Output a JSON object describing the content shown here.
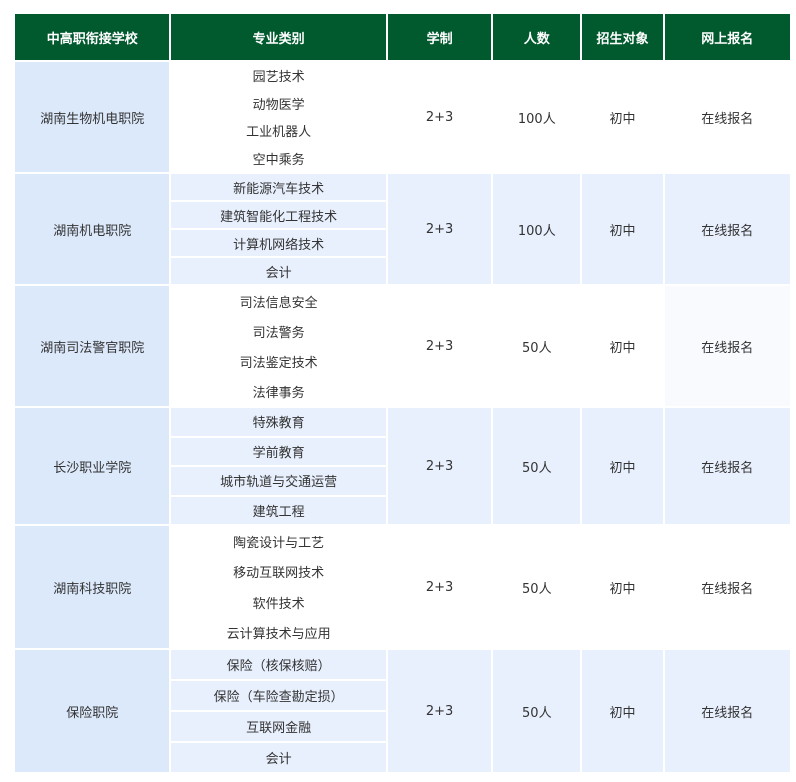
{
  "header": {
    "col_school": "中高职衔接学校",
    "col_major": "专业类别",
    "col_duration": "学制",
    "col_count": "人数",
    "col_target": "招生对象",
    "col_signup": "网上报名"
  },
  "rows": [
    {
      "school": "湖南生物机电职院",
      "majors": [
        "园艺技术",
        "动物医学",
        "工业机器人",
        "空中乘务"
      ],
      "duration": "2+3",
      "count": "100人",
      "target": "初中",
      "signup": "在线报名"
    },
    {
      "school": "湖南机电职院",
      "majors": [
        "新能源汽车技术",
        "建筑智能化工程技术",
        "计算机网络技术",
        "会计"
      ],
      "duration": "2+3",
      "count": "100人",
      "target": "初中",
      "signup": "在线报名"
    },
    {
      "school": "湖南司法警官职院",
      "majors": [
        "司法信息安全",
        "司法警务",
        "司法鉴定技术",
        "法律事务"
      ],
      "duration": "2+3",
      "count": "50人",
      "target": "初中",
      "signup": "在线报名"
    },
    {
      "school": "长沙职业学院",
      "majors": [
        "特殊教育",
        "学前教育",
        "城市轨道与交通运营",
        "建筑工程"
      ],
      "duration": "2+3",
      "count": "50人",
      "target": "初中",
      "signup": "在线报名"
    },
    {
      "school": "湖南科技职院",
      "majors": [
        "陶瓷设计与工艺",
        "移动互联网技术",
        "软件技术",
        "云计算技术与应用"
      ],
      "duration": "2+3",
      "count": "50人",
      "target": "初中",
      "signup": "在线报名"
    },
    {
      "school": "保险职院",
      "majors": [
        "保险（核保核赔）",
        "保险（车险查勘定损）",
        "互联网金融",
        "会计"
      ],
      "duration": "2+3",
      "count": "50人",
      "target": "初中",
      "signup": "在线报名"
    }
  ],
  "colors": {
    "header_bg": "#005a2e",
    "school_bg": "#dce9fb",
    "alt_row_bg": "#e8f0fd"
  }
}
